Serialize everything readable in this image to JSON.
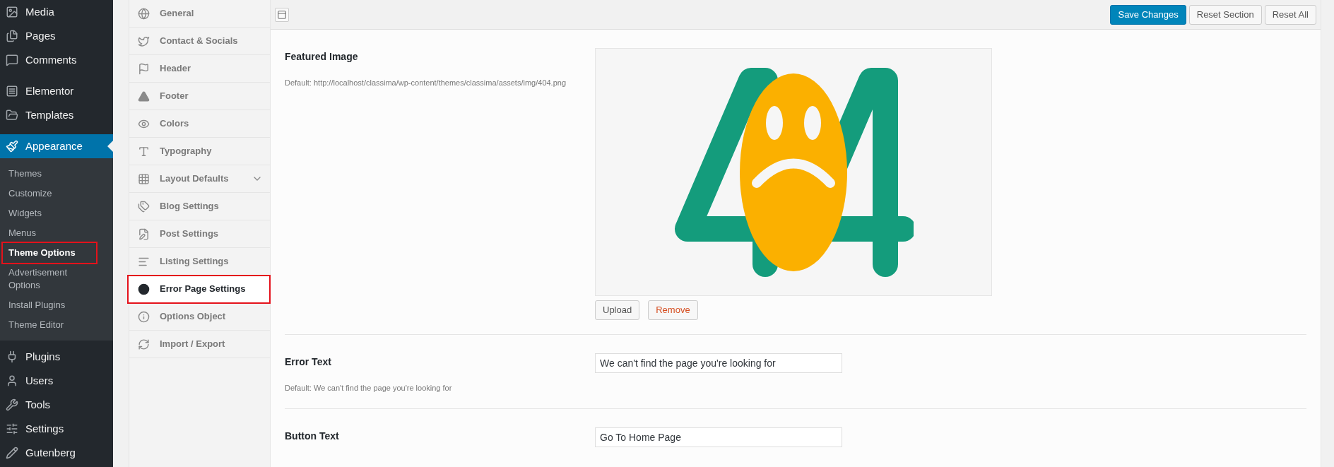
{
  "admin_menu": [
    {
      "label": "Media",
      "selected": false
    },
    {
      "label": "Pages",
      "selected": false
    },
    {
      "label": "Comments",
      "selected": false
    },
    {
      "label": "Elementor",
      "selected": false
    },
    {
      "label": "Templates",
      "selected": false
    },
    {
      "label": "Appearance",
      "selected": true,
      "children": [
        {
          "label": "Themes",
          "selected": false,
          "annotated": false
        },
        {
          "label": "Customize",
          "selected": false,
          "annotated": false
        },
        {
          "label": "Widgets",
          "selected": false,
          "annotated": false
        },
        {
          "label": "Menus",
          "selected": false,
          "annotated": false
        },
        {
          "label": "Theme Options",
          "selected": true,
          "annotated": true
        },
        {
          "label": "Advertisement Options",
          "selected": false,
          "annotated": false
        },
        {
          "label": "Install Plugins",
          "selected": false,
          "annotated": false
        },
        {
          "label": "Theme Editor",
          "selected": false,
          "annotated": false
        }
      ]
    },
    {
      "label": "Plugins",
      "selected": false
    },
    {
      "label": "Users",
      "selected": false
    },
    {
      "label": "Tools",
      "selected": false
    },
    {
      "label": "Settings",
      "selected": false
    },
    {
      "label": "Gutenberg",
      "selected": false
    }
  ],
  "options_nav": [
    {
      "label": "General",
      "selected": false,
      "annotated": false,
      "expandable": false
    },
    {
      "label": "Contact & Socials",
      "selected": false,
      "annotated": false,
      "expandable": false
    },
    {
      "label": "Header",
      "selected": false,
      "annotated": false,
      "expandable": false
    },
    {
      "label": "Footer",
      "selected": false,
      "annotated": false,
      "expandable": false
    },
    {
      "label": "Colors",
      "selected": false,
      "annotated": false,
      "expandable": false
    },
    {
      "label": "Typography",
      "selected": false,
      "annotated": false,
      "expandable": false
    },
    {
      "label": "Layout Defaults",
      "selected": false,
      "annotated": false,
      "expandable": true
    },
    {
      "label": "Blog Settings",
      "selected": false,
      "annotated": false,
      "expandable": false
    },
    {
      "label": "Post Settings",
      "selected": false,
      "annotated": false,
      "expandable": false
    },
    {
      "label": "Listing Settings",
      "selected": false,
      "annotated": false,
      "expandable": false
    },
    {
      "label": "Error Page Settings",
      "selected": true,
      "annotated": true,
      "expandable": false
    },
    {
      "label": "Options Object",
      "selected": false,
      "annotated": false,
      "expandable": false
    },
    {
      "label": "Import / Export",
      "selected": false,
      "annotated": false,
      "expandable": false
    }
  ],
  "toolbar": {
    "buttons": [
      {
        "label": "Save Changes",
        "kind": "primary"
      },
      {
        "label": "Reset Section",
        "kind": "secondary"
      },
      {
        "label": "Reset All",
        "kind": "secondary"
      }
    ]
  },
  "fields": [
    {
      "kind": "image",
      "label": "Featured Image",
      "description": "Default: http://localhost/classima/wp-content/themes/classima/assets/img/404.png",
      "buttons": [
        {
          "label": "Upload",
          "kind": "normal"
        },
        {
          "label": "Remove",
          "kind": "danger"
        }
      ]
    },
    {
      "kind": "text",
      "label": "Error Text",
      "description": "Default: We can't find the page you're looking for",
      "value": "We can't find the page you're looking for"
    },
    {
      "kind": "text",
      "label": "Button Text",
      "value": "Go To Home Page"
    }
  ]
}
